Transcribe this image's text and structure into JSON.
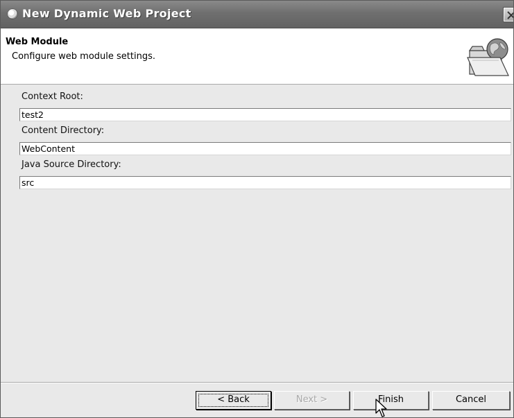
{
  "window": {
    "title": "New Dynamic Web Project",
    "app_icon": "eclipse-icon",
    "close_icon": "close-icon"
  },
  "header": {
    "heading": "Web Module",
    "description": "Configure web module settings.",
    "banner_icon": "web-folder-globe-icon"
  },
  "form": {
    "context_root": {
      "label": "Context Root:",
      "value": "test2"
    },
    "content_directory": {
      "label": "Content Directory:",
      "value": "WebContent"
    },
    "java_source_directory": {
      "label": "Java Source Directory:",
      "value": "src"
    }
  },
  "buttons": {
    "back": "< Back",
    "next": "Next >",
    "finish": "Finish",
    "cancel": "Cancel"
  },
  "colors": {
    "titlebar": "#6f6f6f",
    "dialog_background": "#e9e9e9",
    "header_background": "#ffffff",
    "disabled_text": "#a8a8a8"
  }
}
